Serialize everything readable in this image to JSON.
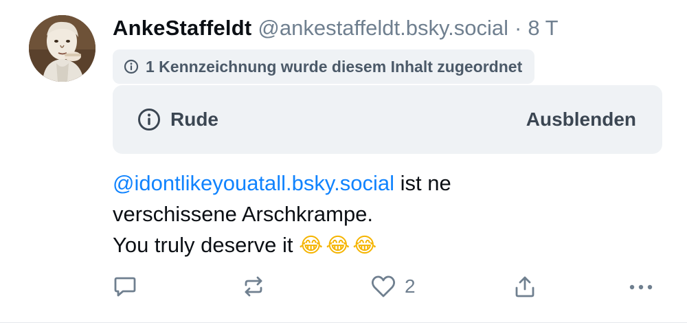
{
  "post": {
    "author": {
      "display_name": "AnkeStaffeldt",
      "handle": "@ankestaffeldt.bsky.social",
      "separator": "·",
      "time": "8 T"
    },
    "label_notice": {
      "icon": "info-circle-icon",
      "text": "1 Kennzeichnung wurde diesem Inhalt zugeordnet"
    },
    "content_warning": {
      "icon": "info-circle-icon",
      "label": "Rude",
      "hide_button": "Ausblenden"
    },
    "text": {
      "mention": "@idontlikeyouatall.bsky.social",
      "line1_rest": " ist ne",
      "line2": "verschissene Arschkrampe.",
      "line3": "You truly deserve it",
      "emojis": "😂😂😂"
    },
    "actions": {
      "reply_icon": "reply-bubble-icon",
      "repost_icon": "repost-icon",
      "like_icon": "heart-icon",
      "like_count": "2",
      "share_icon": "share-icon",
      "more_icon": "more-dots-icon"
    },
    "colors": {
      "mention": "#1083fe",
      "muted": "#6f7f8f",
      "panel_bg": "#eff2f5"
    }
  }
}
